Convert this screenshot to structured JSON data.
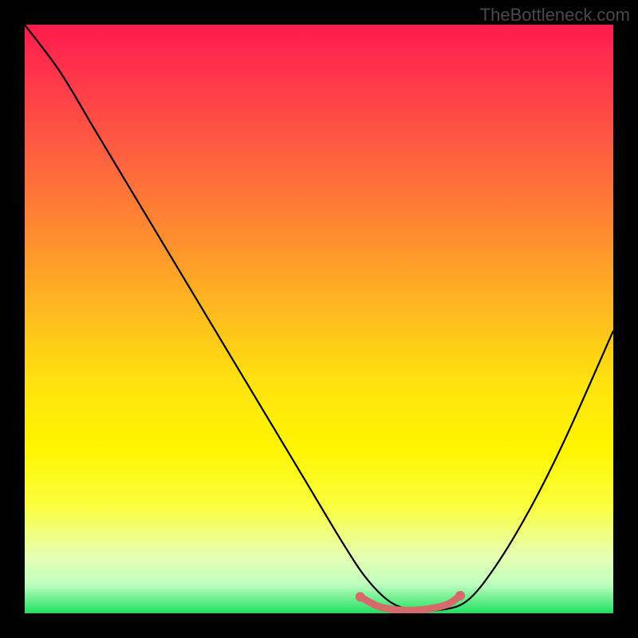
{
  "watermark": "TheBottleneck.com",
  "chart_data": {
    "type": "line",
    "title": "",
    "xlabel": "",
    "ylabel": "",
    "xlim": [
      0,
      100
    ],
    "ylim": [
      0,
      100
    ],
    "gradient_stops": [
      {
        "pos": 0,
        "color": "#ff1a4d"
      },
      {
        "pos": 0.5,
        "color": "#ffd000"
      },
      {
        "pos": 1.0,
        "color": "#20e060"
      }
    ],
    "series": [
      {
        "name": "bottleneck-curve",
        "color": "#000000",
        "x": [
          0,
          6,
          12,
          18,
          24,
          30,
          36,
          42,
          48,
          54,
          58,
          62,
          66,
          70,
          75,
          80,
          86,
          92,
          100
        ],
        "y": [
          100,
          92,
          82,
          72,
          62,
          52,
          42,
          32,
          22,
          12,
          6,
          2,
          0.5,
          0.5,
          2,
          8,
          18,
          30,
          48
        ]
      },
      {
        "name": "optimal-range-marker",
        "color": "#d46a6a",
        "x": [
          57,
          60,
          63,
          66,
          69,
          72,
          74
        ],
        "y": [
          2.8,
          1.2,
          0.6,
          0.5,
          0.8,
          1.6,
          3.0
        ]
      }
    ],
    "annotations": []
  }
}
